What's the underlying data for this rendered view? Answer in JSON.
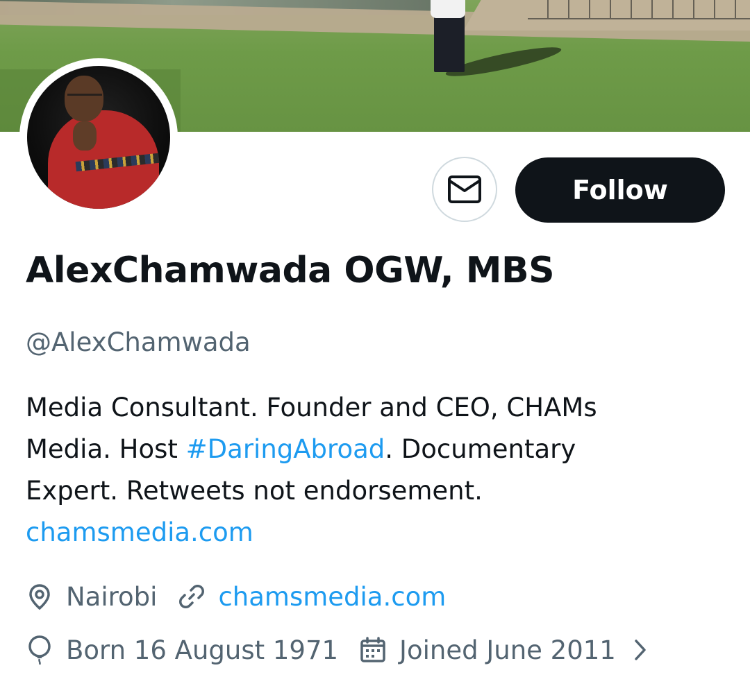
{
  "profile": {
    "display_name": "AlexChamwada OGW, MBS",
    "handle": "@AlexChamwada",
    "avatar_alt": "avatar",
    "banner_alt": "banner-photo"
  },
  "actions": {
    "message_icon": "envelope-icon",
    "follow_label": "Follow"
  },
  "bio": {
    "line1": "Media Consultant. Founder and CEO, CHAMs",
    "line2_prefix": "Media. Host ",
    "line2_hashtag": "#DaringAbroad",
    "line2_suffix": ". Documentary",
    "line3": "Expert. Retweets not endorsement.",
    "line4_link": "chamsmedia.com"
  },
  "meta": {
    "location": "Nairobi",
    "website": "chamsmedia.com",
    "birthday": "Born 16 August 1971",
    "joined": "Joined June 2011"
  },
  "icons": {
    "location": "map-pin-icon",
    "link": "link-icon",
    "birthday": "balloon-icon",
    "joined": "calendar-icon",
    "more": "chevron-right-icon"
  },
  "colors": {
    "link": "#1d9bf0",
    "muted": "#536471",
    "text": "#0f1419",
    "follow_bg": "#0f1419"
  }
}
